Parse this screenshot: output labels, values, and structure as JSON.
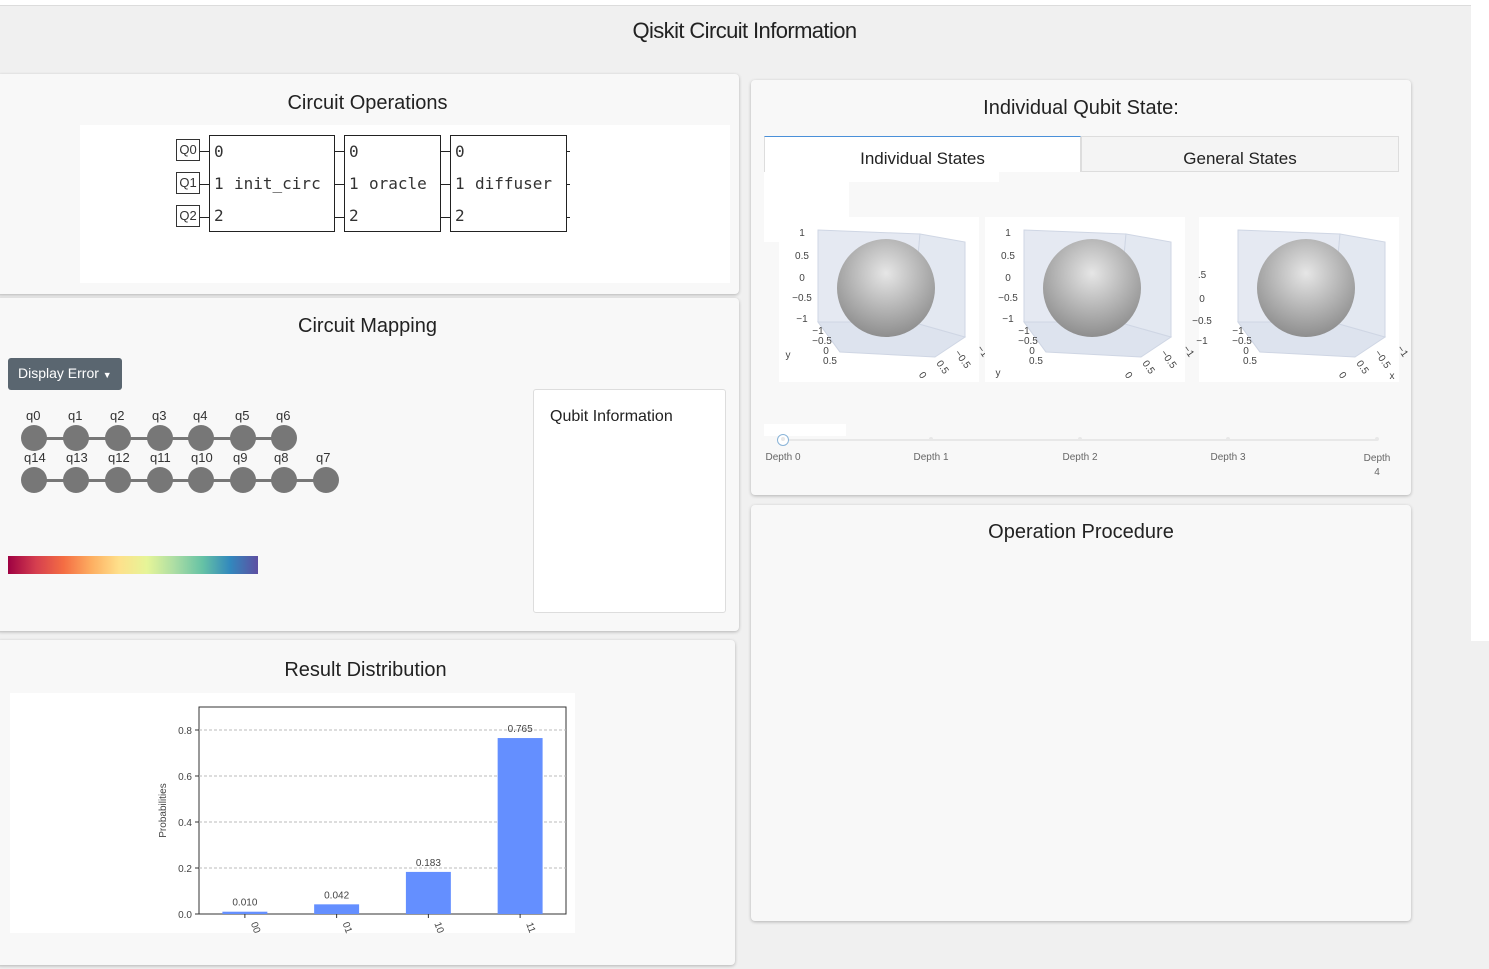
{
  "page": {
    "title": "Qiskit Circuit Information"
  },
  "circuit_operations": {
    "title": "Circuit Operations",
    "qubits": [
      "Q0",
      "Q1",
      "Q2"
    ],
    "gates": [
      {
        "name": "init_circ",
        "ports": [
          "0",
          "1",
          "2"
        ]
      },
      {
        "name": "oracle",
        "ports": [
          "0",
          "1",
          "2"
        ]
      },
      {
        "name": "diffuser",
        "ports": [
          "0",
          "1",
          "2"
        ]
      }
    ]
  },
  "circuit_mapping": {
    "title": "Circuit Mapping",
    "display_button": "Display Error",
    "top_row": [
      "q0",
      "q1",
      "q2",
      "q3",
      "q4",
      "q5",
      "q6"
    ],
    "bottom_row": [
      "q14",
      "q13",
      "q12",
      "q11",
      "q10",
      "q9",
      "q8",
      "q7"
    ],
    "colorbar_colors": [
      "#9e0142",
      "#d53e4f",
      "#f46d43",
      "#fdae61",
      "#fee08b",
      "#e6f598",
      "#abdda4",
      "#66c2a5",
      "#3288bd",
      "#5e4fa2"
    ],
    "qubit_info": {
      "title": "Qubit Information"
    }
  },
  "qubit_state": {
    "title": "Individual Qubit State:",
    "tabs": [
      {
        "label": "Individual States",
        "active": true
      },
      {
        "label": "General States",
        "active": false
      }
    ],
    "sphere_ticks": {
      "z": [
        "1",
        "0.5",
        "0",
        "−0.5",
        "−1"
      ],
      "y": [
        "−1",
        "−0.5",
        "0",
        "0.5"
      ],
      "x": [
        "0",
        "0.5",
        "−0.5",
        "−1"
      ],
      "axis_y": "y",
      "axis_x": "x",
      "third_z": [
        ".5",
        "0",
        "−0.5",
        "−1"
      ]
    },
    "slider": {
      "labels": [
        "Depth 0",
        "Depth 1",
        "Depth 2",
        "Depth 3",
        "Depth 4"
      ],
      "current": 0
    }
  },
  "operation_procedure": {
    "title": "Operation Procedure"
  },
  "result_distribution": {
    "title": "Result Distribution"
  },
  "chart_data": {
    "type": "bar",
    "categories": [
      "00",
      "01",
      "10",
      "11"
    ],
    "values": [
      0.01,
      0.042,
      0.183,
      0.765
    ],
    "value_labels": [
      "0.010",
      "0.042",
      "0.183",
      "0.765"
    ],
    "ylabel": "Probabilities",
    "ylim": [
      0,
      0.9
    ],
    "yticks": [
      "0.0",
      "0.2",
      "0.4",
      "0.6",
      "0.8"
    ],
    "bar_color": "#648fff",
    "grid": true
  }
}
